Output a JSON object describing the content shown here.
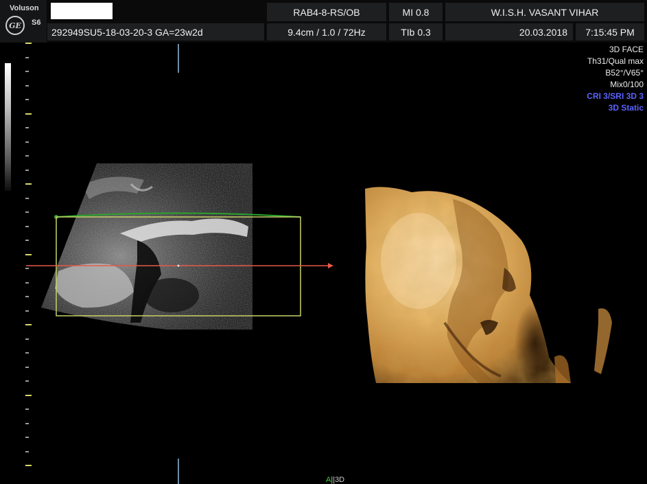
{
  "header": {
    "brand_name": "Voluson",
    "brand_model": "S6",
    "logo_text": "GE",
    "patient_id": "292949SU5-18-03-20-3  GA=23w2d",
    "probe": "RAB4-8-RS/OB",
    "mi": "MI  0.8",
    "institution": "W.I.S.H. VASANT VIHAR",
    "depth_settings": "9.4cm / 1.0 / 72Hz",
    "tib": "TIb  0.3",
    "date": "20.03.2018",
    "time": "7:15:45 PM"
  },
  "overlay": {
    "mode": "3D FACE",
    "quality": "Th31/Qual max",
    "angles": "B52°/V65°",
    "mix": "Mix0/100",
    "cri": "CRI 3/SRI 3D 3",
    "render": "3D Static"
  },
  "bottom_marker": {
    "a": "A",
    "sep": "||",
    "label": "3D"
  },
  "colors": {
    "roi_green": "#2aa52a",
    "roi_yellow": "#c8d26a",
    "cut_line": "#e8594a",
    "render_tint": "#e9b56a",
    "header_bg": "#1e1f21",
    "overlay_blue": "#5b63ff"
  }
}
